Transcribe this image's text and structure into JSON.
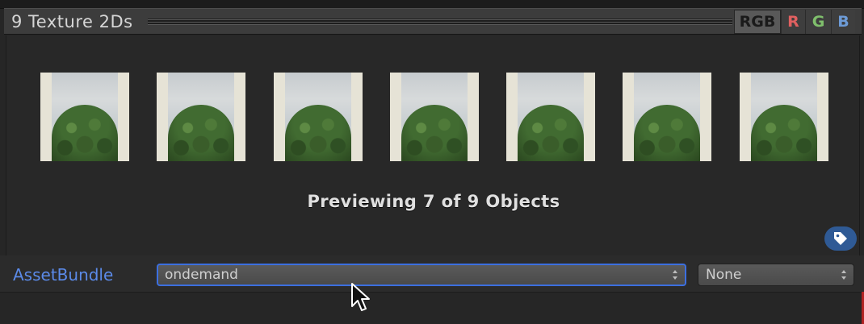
{
  "header": {
    "title": "9 Texture 2Ds",
    "channels": {
      "rgb": "RGB",
      "r": "R",
      "g": "G",
      "b": "B"
    }
  },
  "preview": {
    "thumbnail_count": 7,
    "caption": "Previewing 7 of 9 Objects",
    "label_icon": "tag-icon"
  },
  "asset_bundle": {
    "label": "AssetBundle",
    "name_value": "ondemand",
    "variant_value": "None",
    "dropdown_icon": "updown-arrows-icon"
  },
  "colors": {
    "accent_blue": "#5b8ae8",
    "focus_ring": "#3c6fe0",
    "tag_bg": "#2f5a95",
    "channel_r": "#e06060",
    "channel_g": "#7fbf6c",
    "channel_b": "#6d9bd6"
  }
}
